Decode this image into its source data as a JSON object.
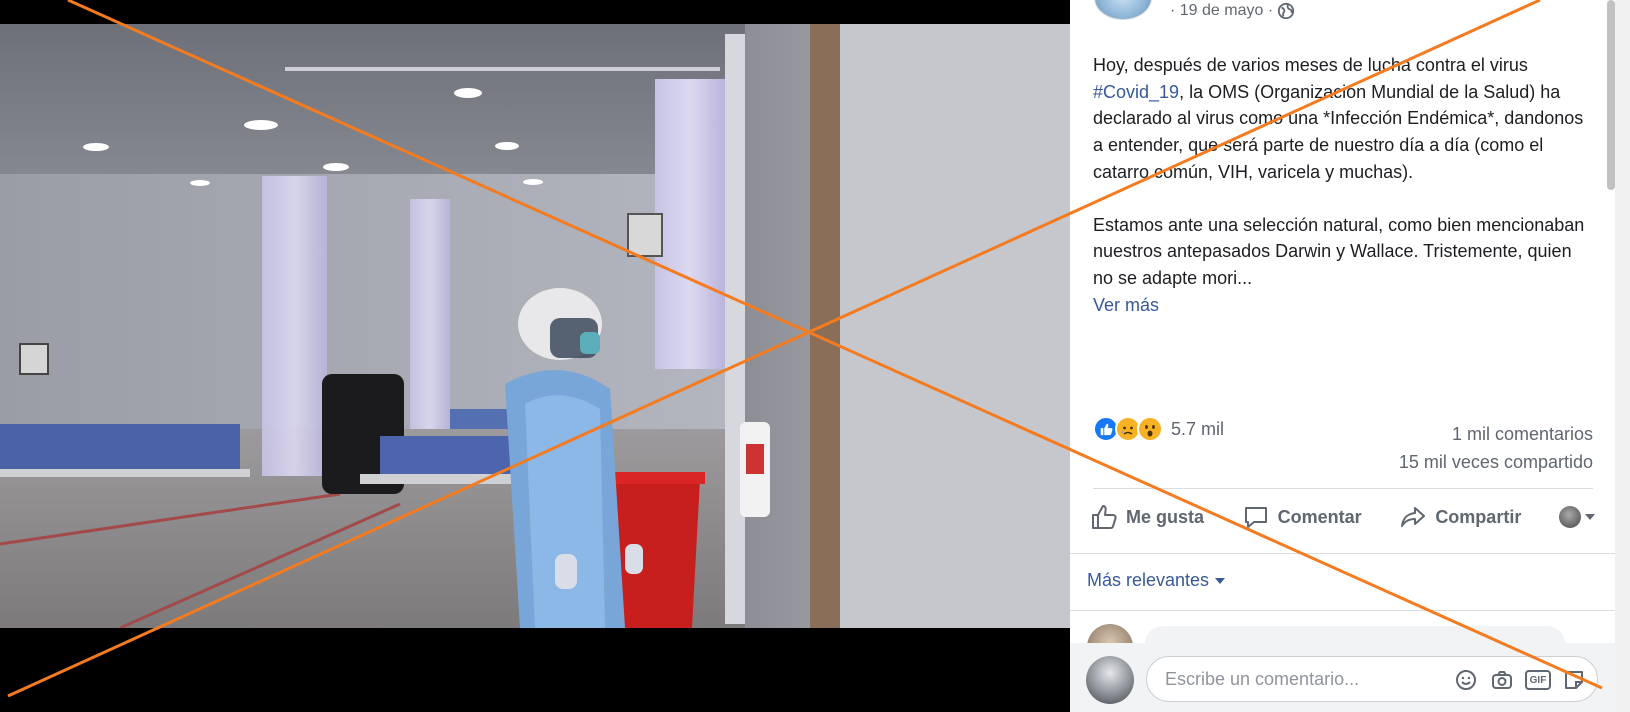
{
  "post": {
    "date": "· 19 de mayo ·",
    "paragraph1_before": "Hoy, después de varios meses de lucha contra el virus ",
    "hashtag": "#Covid_19",
    "paragraph1_after": ", la OMS (Organización Mundial de la Salud) ha declarado al virus como una *Infección Endémica*, dandonos a entender, que será parte de nuestro día a día (como el catarro común, VIH, varicela y muchas).",
    "paragraph2": "Estamos ante una selección natural, como bien mencionaban nuestros antepasados Darwin y Wallace. Tristemente, quien no se adapte mori...",
    "see_more": "Ver más"
  },
  "reactions": {
    "count": "5.7 mil",
    "icons": [
      "like-icon",
      "sad-icon",
      "wow-icon"
    ]
  },
  "stats": {
    "comments": "1 mil comentarios",
    "shares": "15 mil veces compartido"
  },
  "actions": {
    "like": "Me gusta",
    "comment": "Comentar",
    "share": "Compartir"
  },
  "comments": {
    "sort_label": "Más relevantes"
  },
  "composer": {
    "placeholder": "Escribe un comentario...",
    "gif_label": "GIF"
  },
  "colors": {
    "link": "#385898",
    "text": "#1c1e21",
    "muted": "#606770",
    "annotation": "#f47b20"
  }
}
